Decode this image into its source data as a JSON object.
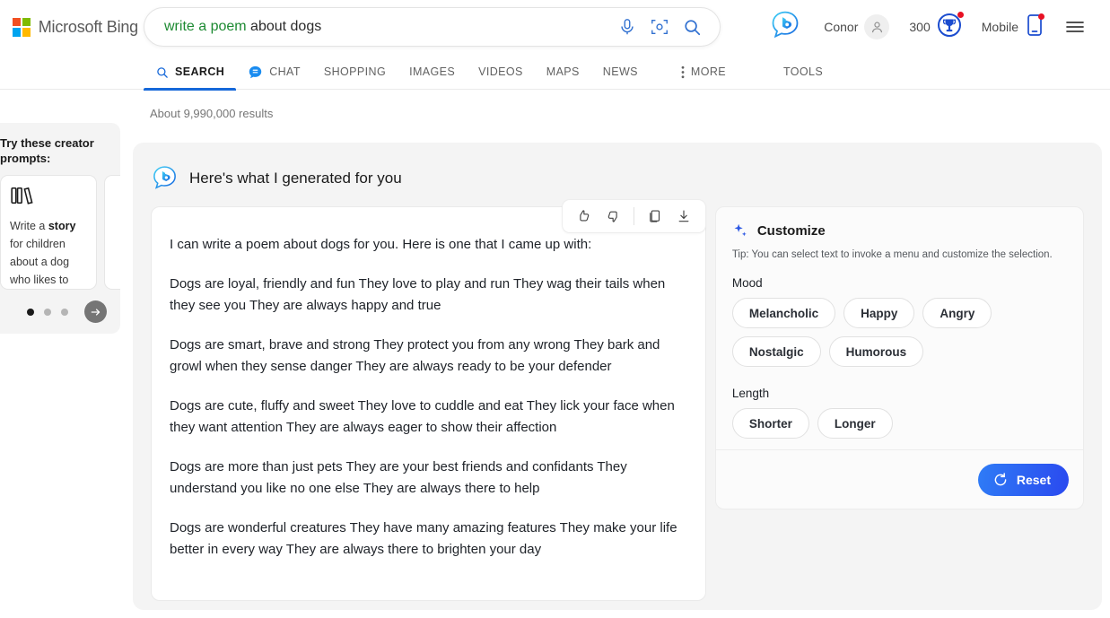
{
  "header": {
    "brand": "Microsoft Bing",
    "search": {
      "query_bold": "write a poem",
      "query_rest": " about dogs",
      "mic_icon": "microphone-icon",
      "camera_icon": "visual-search-camera-icon",
      "search_icon": "search-icon"
    },
    "chat_icon": "bing-chat-icon",
    "account_name": "Conor",
    "rewards_points": "300",
    "rewards_icon": "rewards-trophy-icon",
    "mobile_label": "Mobile",
    "mobile_icon": "mobile-phone-icon",
    "menu_icon": "hamburger-menu-icon"
  },
  "tabs": [
    {
      "label": "SEARCH",
      "icon": "search-icon",
      "active": true
    },
    {
      "label": "CHAT",
      "icon": "chat-bubble-icon",
      "active": false
    },
    {
      "label": "SHOPPING",
      "icon": "",
      "active": false
    },
    {
      "label": "IMAGES",
      "icon": "",
      "active": false
    },
    {
      "label": "VIDEOS",
      "icon": "",
      "active": false
    },
    {
      "label": "MAPS",
      "icon": "",
      "active": false
    },
    {
      "label": "NEWS",
      "icon": "",
      "active": false
    },
    {
      "label": "MORE",
      "icon": "vertical-dots-icon",
      "active": false
    },
    {
      "label": "TOOLS",
      "icon": "",
      "active": false
    }
  ],
  "results_count": "About 9,990,000 results",
  "creator_prompts": {
    "title": "Try these creator prompts:",
    "card_icon": "books-shelf-icon",
    "card_text_pre": "Write a ",
    "card_text_bold": "story",
    "card_text_post": " for children about a dog who likes to run fast and…",
    "dots": 3,
    "active_dot": 0,
    "next_icon": "arrow-right-circle-icon"
  },
  "answer": {
    "heading": "Here's what I generated for you",
    "heading_icon": "bing-chat-icon",
    "feedback": {
      "like_icon": "thumbs-up-icon",
      "dislike_icon": "thumbs-down-icon",
      "copy_icon": "copy-icon",
      "download_icon": "download-icon"
    },
    "paragraphs": [
      "I can write a poem about dogs for you. Here is one that I came up with:",
      "Dogs are loyal, friendly and fun They love to play and run They wag their tails when they see you They are always happy and true",
      "Dogs are smart, brave and strong They protect you from any wrong They bark and growl when they sense danger They are always ready to be your defender",
      "Dogs are cute, fluffy and sweet They love to cuddle and eat They lick your face when they want attention They are always eager to show their affection",
      "Dogs are more than just pets They are your best friends and confidants They understand you like no one else They are always there to help",
      "Dogs are wonderful creatures They have many amazing features They make your life better in every way They are always there to brighten your day"
    ]
  },
  "customize": {
    "title": "Customize",
    "title_icon": "sparkle-icon",
    "tip": "Tip: You can select text to invoke a menu and customize the selection.",
    "mood_label": "Mood",
    "mood_options": [
      "Melancholic",
      "Happy",
      "Angry",
      "Nostalgic",
      "Humorous"
    ],
    "length_label": "Length",
    "length_options": [
      "Shorter",
      "Longer"
    ],
    "reset_label": "Reset",
    "reset_icon": "refresh-icon"
  },
  "colors": {
    "accent_blue": "#1668d9",
    "query_green": "#1d8a32",
    "reset_gradient_start": "#2f7cf6",
    "reset_gradient_end": "#2a49ef",
    "notification_red": "#e81123",
    "panel_gray": "#f4f4f4"
  }
}
